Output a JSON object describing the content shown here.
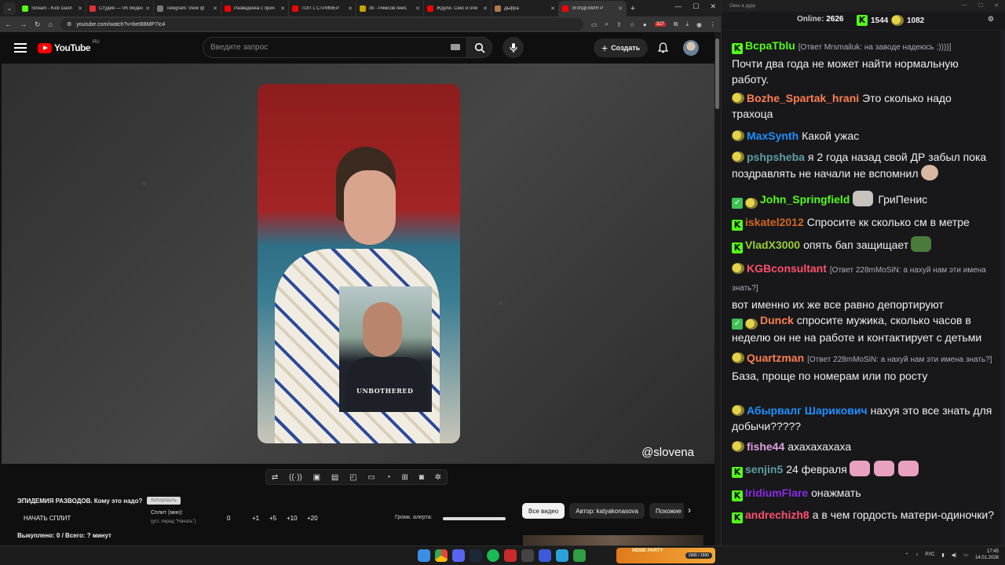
{
  "browser": {
    "tabs": [
      {
        "title": "Stream - Kick Dash",
        "color": "#53fc18"
      },
      {
        "title": "Студия — VK Видео",
        "color": "#e03131"
      },
      {
        "title": "Telegram: View @",
        "color": "#777"
      },
      {
        "title": "Разведёнка с прич",
        "color": "#ff0000"
      },
      {
        "title": "ТОП 1 СТРИМЕР ",
        "color": "#ff0000"
      },
      {
        "title": "/b/ - Римсов reels",
        "color": "#c8a400"
      },
      {
        "title": "Ждули. Секс и опи",
        "color": "#ff0000"
      },
      {
        "title": "Дьфра",
        "color": "#b07a4a"
      },
      {
        "title": "ЭПИДЕМИЯ Р",
        "color": "#ff0000",
        "active": true
      }
    ],
    "new_tab": "+",
    "url": "youtube.com/watch?v=beI88MP7Ic4",
    "badge_count": "327"
  },
  "youtube": {
    "logo_text": "YouTube",
    "logo_region": "RU",
    "search_placeholder": "Введите запрос",
    "create_label": "Создать",
    "video_watermark": "@slovena",
    "pip_shirt_text": "UNBOTHERED",
    "controls_icons": [
      "repeat-icon",
      "wifi-icon",
      "clip-icon",
      "film-icon",
      "miniplayer-icon",
      "theater-icon",
      "speed-icon",
      "plus-icon",
      "camera-icon",
      "gear-icon"
    ],
    "video_title": "ЭПИДЕМИЯ РАЗВОДОВ. Кому это надо?",
    "copy_pill": "Копировать",
    "split_start": "НАЧАТЬ СПЛИТ",
    "split_label": "Сплит (мин):",
    "split_sub": "(уст. перед \"Начать\")",
    "split_value": "0",
    "increments": [
      "+1",
      "+5",
      "+10",
      "+20"
    ],
    "bought": "Выкуплено: 0 / Всего: ? минут",
    "alert_label": "Громк. алерта:",
    "alert_volume": 1.0,
    "chips": [
      "Все видео",
      "Автор: katyakonasova",
      "Похожие"
    ]
  },
  "chat": {
    "window_title": "Окно в дуру",
    "online_label": "Online:",
    "online_count": "2626",
    "kick_count": "1544",
    "other_count": "1082",
    "messages": [
      {
        "badges": [
          "kick"
        ],
        "nick": "BcpaTblu",
        "color": "#53fc18",
        "reply": "[Ответ Mrsmailuk: на заводе надеюсь :))))]",
        "text": "Почти два года не может найти нормальную работу."
      },
      {
        "badges": [
          "pepe"
        ],
        "nick": "Bozhe_Spartak_hrani",
        "color": "#ff7f50",
        "text": "Это сколько надо трахоца"
      },
      {
        "badges": [
          "pepe"
        ],
        "nick": "MaxSynth",
        "color": "#1e90ff",
        "text": "Какой ужас"
      },
      {
        "badges": [
          "pepe"
        ],
        "nick": "pshpsheba",
        "color": "#5f9ea0",
        "text": "я 2 года назад свой ДР забыл пока поздравлять не начали не вспомнил"
      },
      {
        "badges": [
          "verified",
          "pepe"
        ],
        "nick": "John_Springfield",
        "color": "#53fc18",
        "text": "ГриПенис"
      },
      {
        "badges": [
          "kick"
        ],
        "nick": "iskatel2012",
        "color": "#d2691e",
        "text": "Спросите кк сколько см в метре"
      },
      {
        "badges": [
          "kick"
        ],
        "nick": "VladX3000",
        "color": "#9acd32",
        "text": "опять бап защищает"
      },
      {
        "badges": [
          "pepe"
        ],
        "nick": "KGBconsultant",
        "color": "#ff4f6d",
        "reply": "[Ответ 228mMoSiN: а нахуй нам эти имена знать?]",
        "text": "вот именно их же все равно депортируют"
      },
      {
        "badges": [
          "verified",
          "pepe"
        ],
        "nick": "Dunck",
        "color": "#ff7f50",
        "text": "спросите мужика, сколько часов в неделю он не на работе и контактирует с детьми"
      },
      {
        "badges": [
          "pepe"
        ],
        "nick": "Quartzman",
        "color": "#ff7f50",
        "reply": "[Ответ 228mMoSiN: а нахуй нам эти имена знать?]",
        "text": "База, проще по номерам или по росту"
      },
      {
        "badges": [
          "pepe"
        ],
        "nick": "Абырвалг Шарикович",
        "color": "#1e90ff",
        "text": "нахуя это все знать для добычи?????"
      },
      {
        "badges": [
          "pepe"
        ],
        "nick": "fishe44",
        "color": "#dda0dd",
        "text": "ахахахахаха"
      },
      {
        "badges": [
          "kick"
        ],
        "nick": "senjin5",
        "color": "#5f9ea0",
        "text": "24 февраля"
      },
      {
        "badges": [
          "kick"
        ],
        "nick": "IridiumFlare",
        "color": "#8a2be2",
        "text": "онажмать"
      },
      {
        "badges": [
          "kick"
        ],
        "nick": "andrechizh8",
        "color": "#ff4f6d",
        "text": "а в чем гордость матери-одиночки?"
      }
    ]
  },
  "taskbar": {
    "media_title": "MEME PARTY",
    "media_counter": "1990 / 1590",
    "lang": "РУС",
    "time": "17:45",
    "date": "14.01.2026"
  }
}
